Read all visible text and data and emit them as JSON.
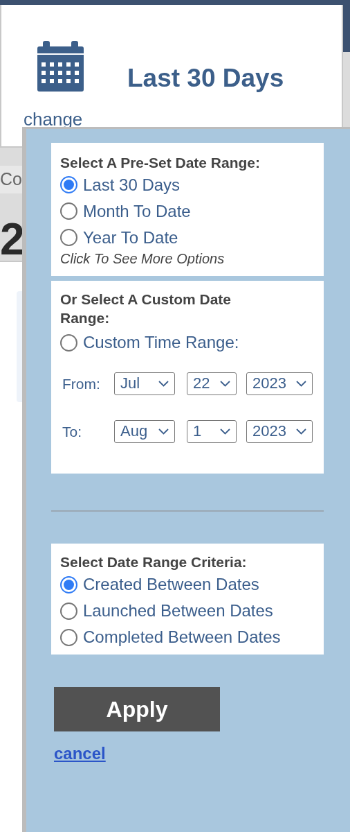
{
  "header": {
    "title": "Last 30 Days",
    "change_link": "change"
  },
  "background": {
    "label": "Co",
    "value": "2"
  },
  "preset": {
    "heading": "Select A Pre-Set Date Range:",
    "options": [
      {
        "label": "Last 30 Days",
        "selected": true
      },
      {
        "label": "Month To Date",
        "selected": false
      },
      {
        "label": "Year To Date",
        "selected": false
      }
    ],
    "more_hint": "Click To See More Options"
  },
  "custom": {
    "heading": "Or Select A Custom Date Range:",
    "option": {
      "label": "Custom Time Range:",
      "selected": false
    },
    "rows": [
      {
        "label": "From:",
        "values": [
          "Jul",
          "22",
          "2023"
        ]
      },
      {
        "label": "To:",
        "values": [
          "Aug",
          "1",
          "2023"
        ]
      }
    ]
  },
  "criteria": {
    "heading": "Select Date Range Criteria:",
    "options": [
      {
        "label": "Created Between Dates",
        "selected": true
      },
      {
        "label": "Launched Between Dates",
        "selected": false
      },
      {
        "label": "Completed Between Dates",
        "selected": false
      }
    ]
  },
  "apply_button": "Apply",
  "cancel_link": "cancel"
}
